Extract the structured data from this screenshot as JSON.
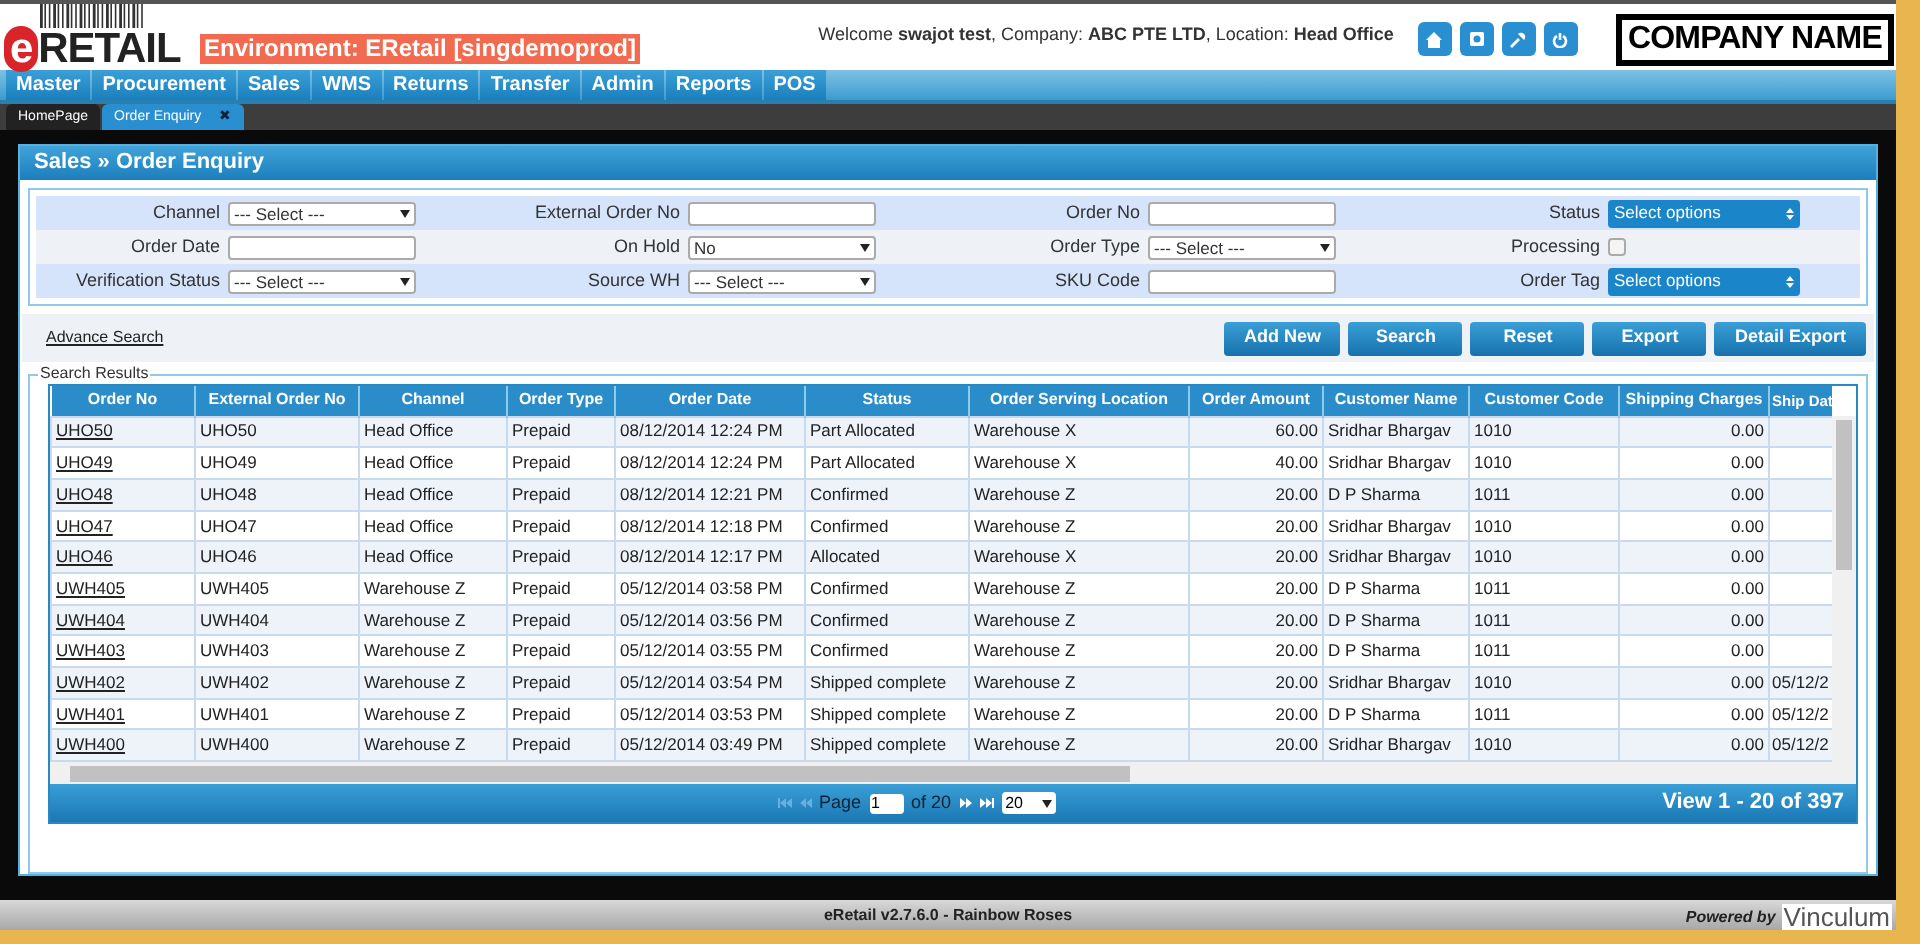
{
  "header": {
    "logo": {
      "prefix": "e",
      "name": "RETAIL"
    },
    "environment": "Environment: ERetail [singdemoprod]",
    "welcome": "Welcome **swajot test**, Company: **ABC PTE LTD**, Location: **Head Office**",
    "company": "COMPANY NAME"
  },
  "menu": [
    "Master",
    "Procurement",
    "Sales",
    "WMS",
    "Returns",
    "Transfer",
    "Admin",
    "Reports",
    "POS"
  ],
  "tabs": [
    {
      "label": "HomePage",
      "selected": false
    },
    {
      "label": "Order Enquiry",
      "selected": true,
      "close": "✖"
    }
  ],
  "panel_title": "Sales » Order Enquiry",
  "filters": [
    [
      {
        "label": "Channel",
        "kind": "select",
        "value": "--- Select ---"
      },
      {
        "label": "External Order No",
        "kind": "input"
      },
      {
        "label": "Order No",
        "kind": "input"
      },
      {
        "label": "Status",
        "kind": "multiselect",
        "value": "Select options"
      }
    ],
    [
      {
        "label": "Order Date",
        "kind": "input"
      },
      {
        "label": "On Hold",
        "kind": "select",
        "value": "No"
      },
      {
        "label": "Order Type",
        "kind": "select",
        "value": "--- Select ---"
      },
      {
        "label": "Processing",
        "kind": "checkbox",
        "checked": false
      }
    ],
    [
      {
        "label": "Verification Status",
        "kind": "select",
        "value": "--- Select ---"
      },
      {
        "label": "Source WH",
        "kind": "select",
        "value": "--- Select ---"
      },
      {
        "label": "SKU Code",
        "kind": "input"
      },
      {
        "label": "Order Tag",
        "kind": "multiselect",
        "value": "Select options"
      }
    ]
  ],
  "advance_search": "Advance Search",
  "buttons": [
    "Add New",
    "Search",
    "Reset",
    "Export",
    "Detail Export"
  ],
  "results_legend": "Search Results",
  "table": {
    "columns": [
      "Order No",
      "External Order No",
      "Channel",
      "Order Type",
      "Order Date",
      "Status",
      "Order Serving Location",
      "Order Amount",
      "Customer Name",
      "Customer Code",
      "Shipping Charges",
      "Ship Dat"
    ],
    "rows": [
      [
        "UHO50",
        "UHO50",
        "Head Office",
        "Prepaid",
        "08/12/2014 12:24 PM",
        "Part Allocated",
        "Warehouse X",
        "60.00",
        "Sridhar Bhargav",
        "1010",
        "0.00",
        ""
      ],
      [
        "UHO49",
        "UHO49",
        "Head Office",
        "Prepaid",
        "08/12/2014 12:24 PM",
        "Part Allocated",
        "Warehouse X",
        "40.00",
        "Sridhar Bhargav",
        "1010",
        "0.00",
        ""
      ],
      [
        "UHO48",
        "UHO48",
        "Head Office",
        "Prepaid",
        "08/12/2014 12:21 PM",
        "Confirmed",
        "Warehouse Z",
        "20.00",
        "D P Sharma",
        "1011",
        "0.00",
        ""
      ],
      [
        "UHO47",
        "UHO47",
        "Head Office",
        "Prepaid",
        "08/12/2014 12:18 PM",
        "Confirmed",
        "Warehouse Z",
        "20.00",
        "Sridhar Bhargav",
        "1010",
        "0.00",
        ""
      ],
      [
        "UHO46",
        "UHO46",
        "Head Office",
        "Prepaid",
        "08/12/2014 12:17 PM",
        "Allocated",
        "Warehouse X",
        "20.00",
        "Sridhar Bhargav",
        "1010",
        "0.00",
        ""
      ],
      [
        "UWH405",
        "UWH405",
        "Warehouse Z",
        "Prepaid",
        "05/12/2014 03:58 PM",
        "Confirmed",
        "Warehouse Z",
        "20.00",
        "D P Sharma",
        "1011",
        "0.00",
        ""
      ],
      [
        "UWH404",
        "UWH404",
        "Warehouse Z",
        "Prepaid",
        "05/12/2014 03:56 PM",
        "Confirmed",
        "Warehouse Z",
        "20.00",
        "D P Sharma",
        "1011",
        "0.00",
        ""
      ],
      [
        "UWH403",
        "UWH403",
        "Warehouse Z",
        "Prepaid",
        "05/12/2014 03:55 PM",
        "Confirmed",
        "Warehouse Z",
        "20.00",
        "D P Sharma",
        "1011",
        "0.00",
        ""
      ],
      [
        "UWH402",
        "UWH402",
        "Warehouse Z",
        "Prepaid",
        "05/12/2014 03:54 PM",
        "Shipped complete",
        "Warehouse Z",
        "20.00",
        "Sridhar Bhargav",
        "1010",
        "0.00",
        "05/12/2"
      ],
      [
        "UWH401",
        "UWH401",
        "Warehouse Z",
        "Prepaid",
        "05/12/2014 03:53 PM",
        "Shipped complete",
        "Warehouse Z",
        "20.00",
        "D P Sharma",
        "1011",
        "0.00",
        "05/12/2"
      ],
      [
        "UWH400",
        "UWH400",
        "Warehouse Z",
        "Prepaid",
        "05/12/2014 03:49 PM",
        "Shipped complete",
        "Warehouse Z",
        "20.00",
        "Sridhar Bhargav",
        "1010",
        "0.00",
        "05/12/2"
      ]
    ]
  },
  "pager": {
    "page_label": "Page",
    "page": "1",
    "of": "of 20",
    "page_size": "20",
    "summary": "View 1 - 20 of 397"
  },
  "footer": {
    "version": "eRetail v2.7.6.0 - Rainbow Roses",
    "powered_by": "Powered by",
    "brand": "Vinculum"
  }
}
